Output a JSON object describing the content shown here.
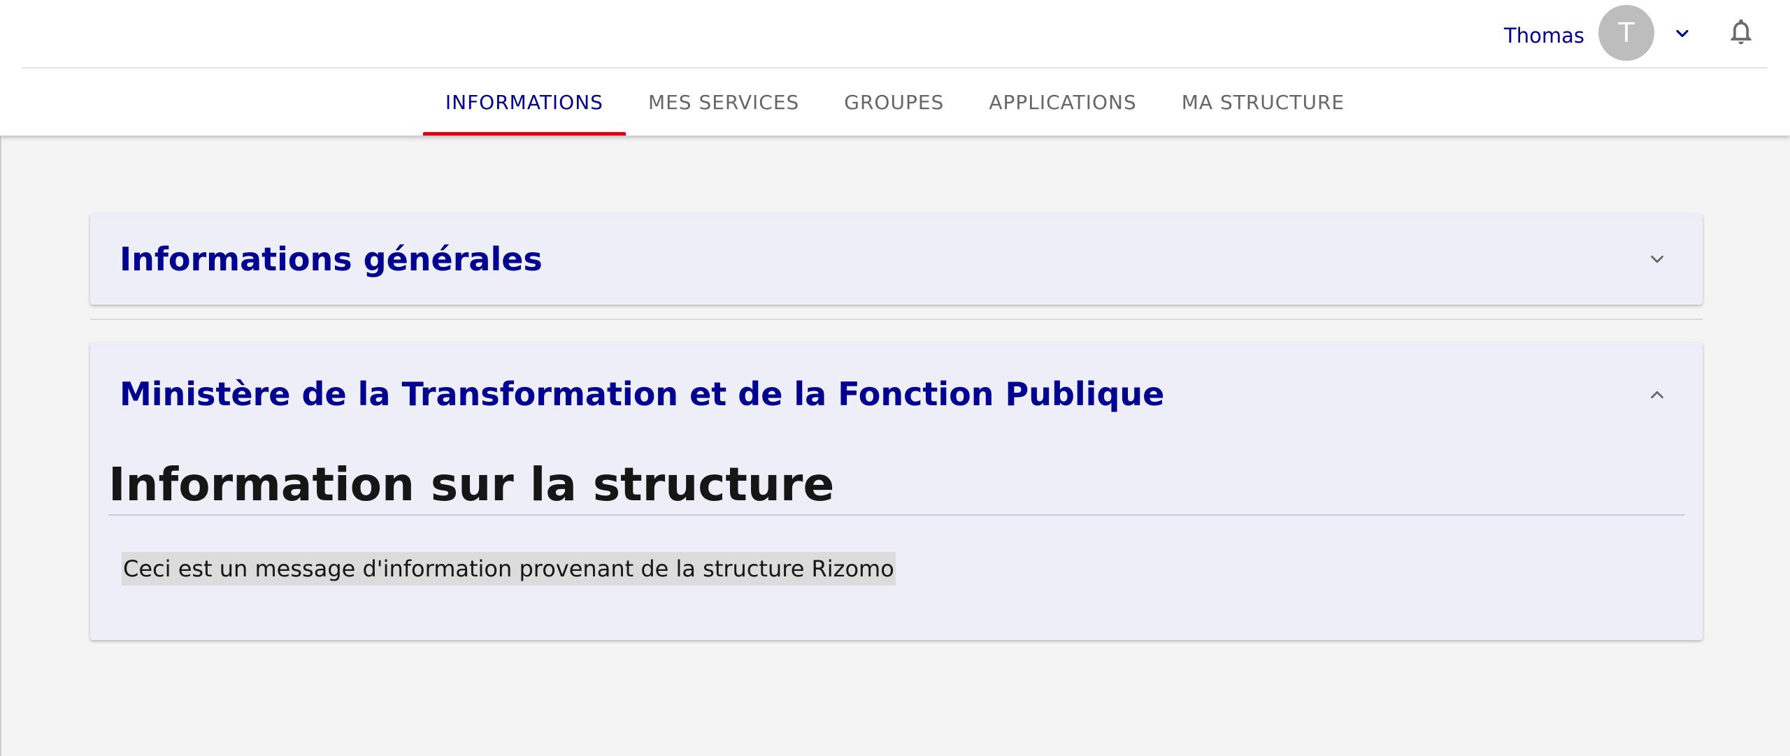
{
  "header": {
    "user_name": "Thomas",
    "avatar_initial": "T",
    "icons": {
      "user_menu": "chevron-down-icon",
      "notifications": "bell-icon"
    }
  },
  "tabs": [
    {
      "label": "INFORMATIONS",
      "active": true
    },
    {
      "label": "MES SERVICES",
      "active": false
    },
    {
      "label": "GROUPES",
      "active": false
    },
    {
      "label": "APPLICATIONS",
      "active": false
    },
    {
      "label": "MA STRUCTURE",
      "active": false
    }
  ],
  "panels": {
    "general": {
      "title": "Informations générales",
      "expanded": false
    },
    "ministry": {
      "title": "Ministère de la Transformation et de la Fonction Publique",
      "expanded": true,
      "section_title": "Information sur la structure",
      "message": "Ceci est un message d'information provenant de la structure Rizomo"
    }
  },
  "colors": {
    "primary": "#000091",
    "active_tab_indicator": "#e1000f",
    "panel_background": "#eeeef8",
    "page_background": "#f4f4f4"
  }
}
